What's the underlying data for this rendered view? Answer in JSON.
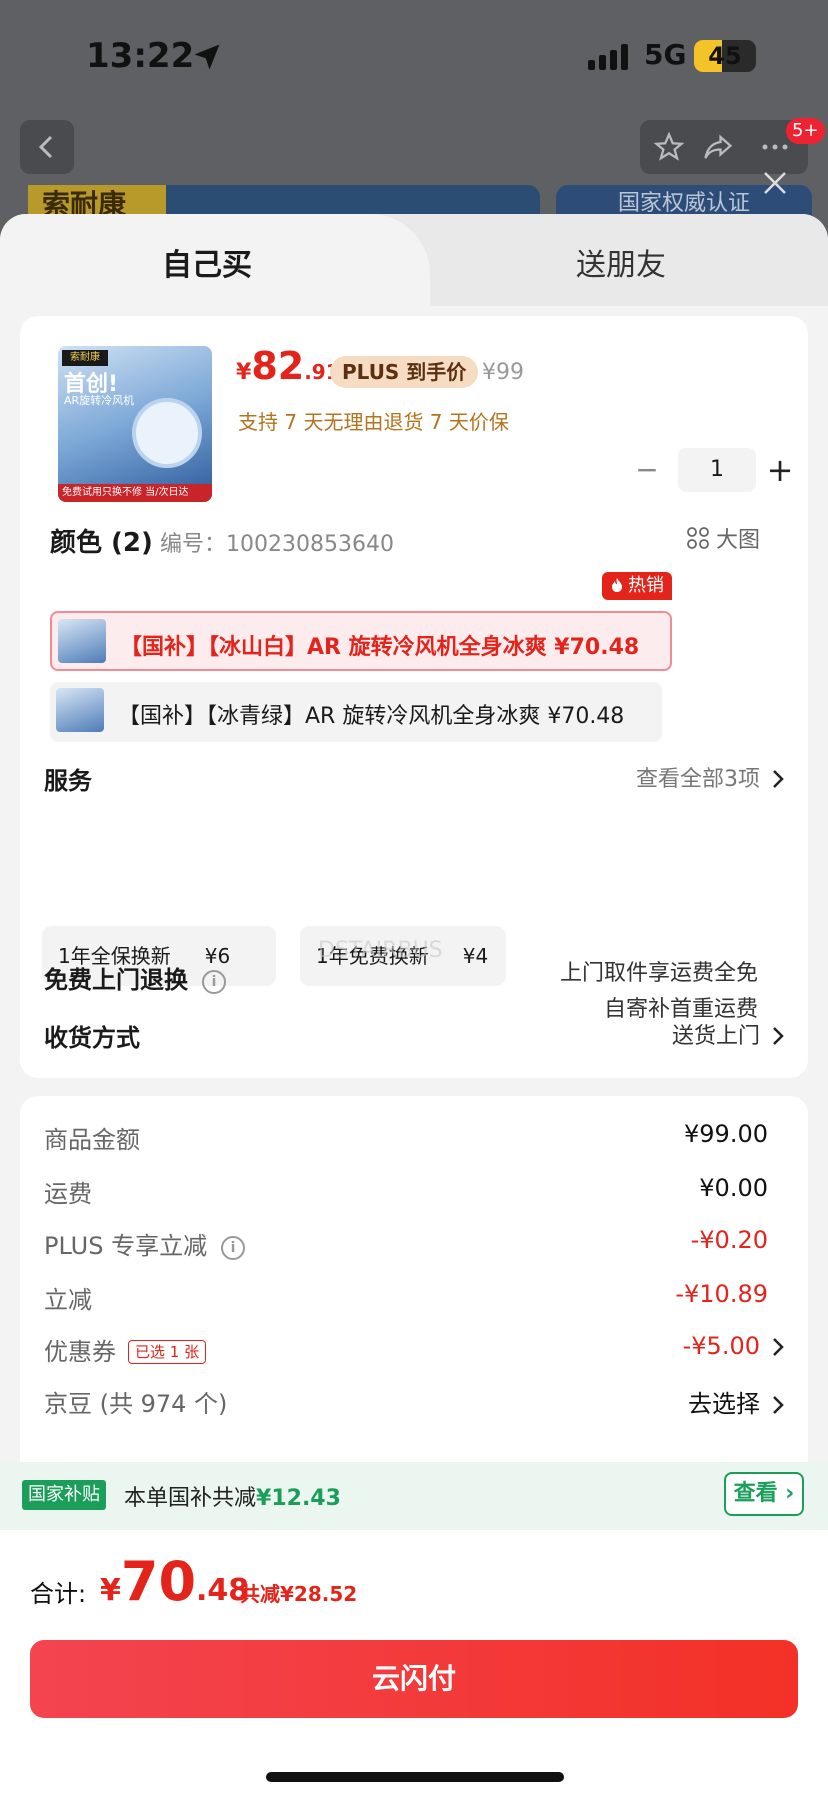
{
  "status_bar": {
    "time": "13:22",
    "network": "5G",
    "battery": "45",
    "battery_level": 0.45
  },
  "top_nav": {
    "notification_badge": "5+"
  },
  "banners": {
    "left_tag": "索耐康",
    "right_text": "国家权威认证"
  },
  "tabs": [
    {
      "label": "自己买",
      "active": true
    },
    {
      "label": "送朋友",
      "active": false
    }
  ],
  "product": {
    "thumb_top": "索耐康",
    "thumb_title": "首创!",
    "thumb_sub": "AR旋转冷风机",
    "thumb_bottom": "免费试用只换不修 当/次日达",
    "price_yen": "¥",
    "price_int": "82",
    "price_dec": ".91",
    "plus_tag": "PLUS 到手价",
    "original_price": "¥99",
    "return_policy": "支持 7 天无理由退货   7 天价保",
    "quantity": "1",
    "qty_minus": "−",
    "qty_plus": "+"
  },
  "color_section": {
    "title": "颜色 (2)",
    "code": "编号：100230853640",
    "big_pic": "大图",
    "hot_badge": "热销",
    "variants": [
      {
        "label": "【国补】【冰山白】AR 旋转冷风机全身冰爽   ¥70.48",
        "selected": true
      },
      {
        "label": "【国补】【冰青绿】AR 旋转冷风机全身冰爽   ¥70.48",
        "selected": false
      }
    ]
  },
  "service": {
    "title": "服务",
    "view_all": "查看全部3项",
    "options": [
      {
        "name": "1年全保换新",
        "price": "¥6"
      },
      {
        "name": "1年免费换新",
        "price": "¥4"
      }
    ],
    "watermark": "DSTAIRBUS"
  },
  "delivery": {
    "label": "收货方式",
    "value": "送货上门"
  },
  "free_return": {
    "label": "免费上门退换",
    "line1": "上门取件享运费全免",
    "line2": "自寄补首重运费"
  },
  "fees": {
    "goods": {
      "label": "商品金额",
      "value": "¥99.00"
    },
    "shipping": {
      "label": "运费",
      "value": "¥0.00"
    },
    "plus": {
      "label": "PLUS 专享立减",
      "value": "-¥0.20"
    },
    "discount": {
      "label": "立减",
      "value": "-¥10.89"
    },
    "coupon": {
      "label": "优惠券",
      "tag": "已选 1 张",
      "value": "-¥5.00"
    },
    "jingdou": {
      "label": "京豆 (共 974 个)",
      "value": "去选择"
    }
  },
  "subsidy": {
    "tag": "国家补贴",
    "text": "本单国补共减",
    "amount": "¥12.43",
    "view": "查看"
  },
  "footer": {
    "total_label": "合计:",
    "total_yen": "¥",
    "total_int": "70",
    "total_dec": ".48",
    "saved": "共减¥28.52",
    "pay_button": "云闪付"
  },
  "colors": {
    "accent_red": "#e4241b",
    "green": "#1a9e5a",
    "plus_gold": "#b4741d"
  }
}
